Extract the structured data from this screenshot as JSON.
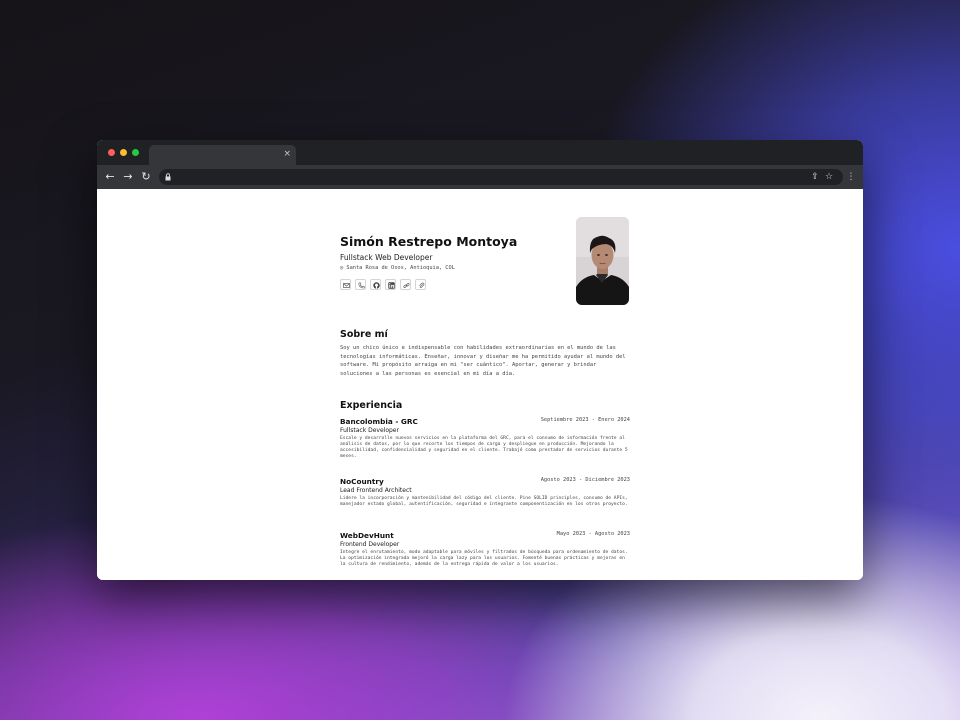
{
  "window": {
    "traffic_lights": {
      "close": "#ff5f57",
      "minimize": "#febc2e",
      "maximize": "#28c840"
    },
    "tab": {
      "close_glyph": "×"
    },
    "toolbar": {
      "back": "←",
      "forward": "→",
      "reload": "↻",
      "share": "⇪",
      "bookmark": "☆",
      "menu": "⋮"
    }
  },
  "profile": {
    "name": "Simón Restrepo Montoya",
    "role": "Fullstack Web Developer",
    "location": "Santa Rosa de Osos, Antioquia, COL",
    "location_icon": "◎",
    "socials": [
      "mail-icon",
      "phone-icon",
      "github-icon",
      "linkedin-icon",
      "link-icon",
      "attachment-icon"
    ]
  },
  "about": {
    "heading": "Sobre mí",
    "text": "Soy un chico único e indispensable con habilidades extraordinarias en el mundo de las tecnologías informáticas. Enseñar, innovar y diseñar me ha permitido ayudar al mundo del software. Mi propósito arraiga en mi \"ser cuántico\". Aportar, generar y brindar soluciones a las personas es esencial en mi día a día."
  },
  "experience": {
    "heading": "Experiencia",
    "jobs": [
      {
        "company": "Bancolombia - GRC",
        "dates": "Septiembre 2023 - Enero 2024",
        "role": "Fullstack Developer",
        "description": "Escale y desarrolle nuevos servicios en la plataforma del GRC, para el consumo de información frente al análisis de datos, por lo que recorte los tiempos de carga y despliegue en producción. Mejorando la accesibilidad, confidencialidad y seguridad en el cliente. Trabajé como prestador de servicios durante 5 meses."
      },
      {
        "company": "NoCountry",
        "dates": "Agosto 2023 - Diciembre 2023",
        "role": "Lead Frontend Architect",
        "description": "Lidere la incorporación y mantenibilidad del código del cliente. Pine SOLID principles, consumo de APIs, manejador estado global, autentificación, seguridad e integrante componentización en los otros proyecto."
      },
      {
        "company": "WebDevHunt",
        "dates": "Mayo 2023 - Agosto 2023",
        "role": "Frontend Developer",
        "description": "Integre el enrutamiento, modo adaptable para móviles y filtrados de búsqueda para ordenamiento de datos. La optimización integrada mejoró la carga lazy para los usuarios. Fomenté buenas prácticas y mejoras en la cultura de rendimiento, además de la entrega rápida de valor a los usuarios."
      }
    ]
  }
}
